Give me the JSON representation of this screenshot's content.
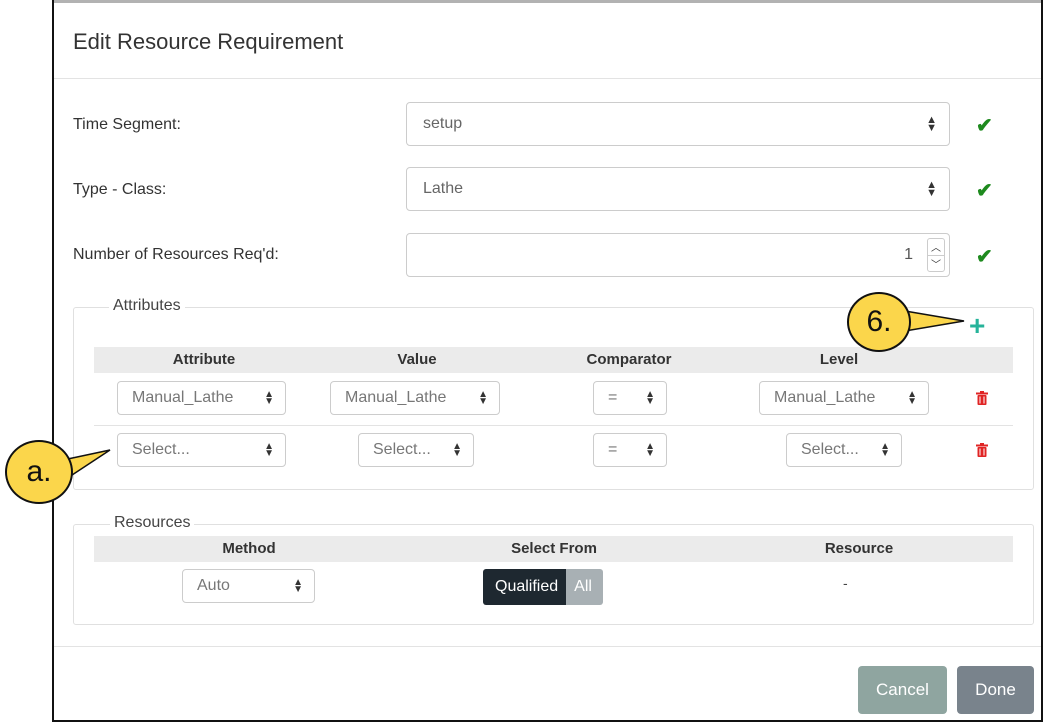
{
  "dialog": {
    "title": "Edit Resource Requirement"
  },
  "form": {
    "time_segment": {
      "label": "Time Segment:",
      "value": "setup"
    },
    "type_class": {
      "label": "Type - Class:",
      "value": "Lathe"
    },
    "num_resources": {
      "label": "Number of Resources Req'd:",
      "value": "1"
    }
  },
  "attributes": {
    "legend": "Attributes",
    "headers": [
      "Attribute",
      "Value",
      "Comparator",
      "Level"
    ],
    "rows": [
      {
        "attribute": "Manual_Lathe",
        "value": "Manual_Lathe",
        "comparator": "=",
        "level": "Manual_Lathe"
      },
      {
        "attribute": "Select...",
        "value": "Select...",
        "comparator": "=",
        "level": "Select..."
      }
    ]
  },
  "resources": {
    "legend": "Resources",
    "headers": [
      "Method",
      "Select From",
      "Resource"
    ],
    "method": "Auto",
    "select_from": {
      "active": "Qualified",
      "inactive": "All"
    },
    "resource": "-"
  },
  "callouts": {
    "six": "6.",
    "a": "a."
  },
  "buttons": {
    "cancel": "Cancel",
    "done": "Done"
  },
  "colors": {
    "check": "#1e8a1e",
    "add": "#26b39a",
    "delete": "#e02424",
    "callout": "#fbd64b"
  }
}
